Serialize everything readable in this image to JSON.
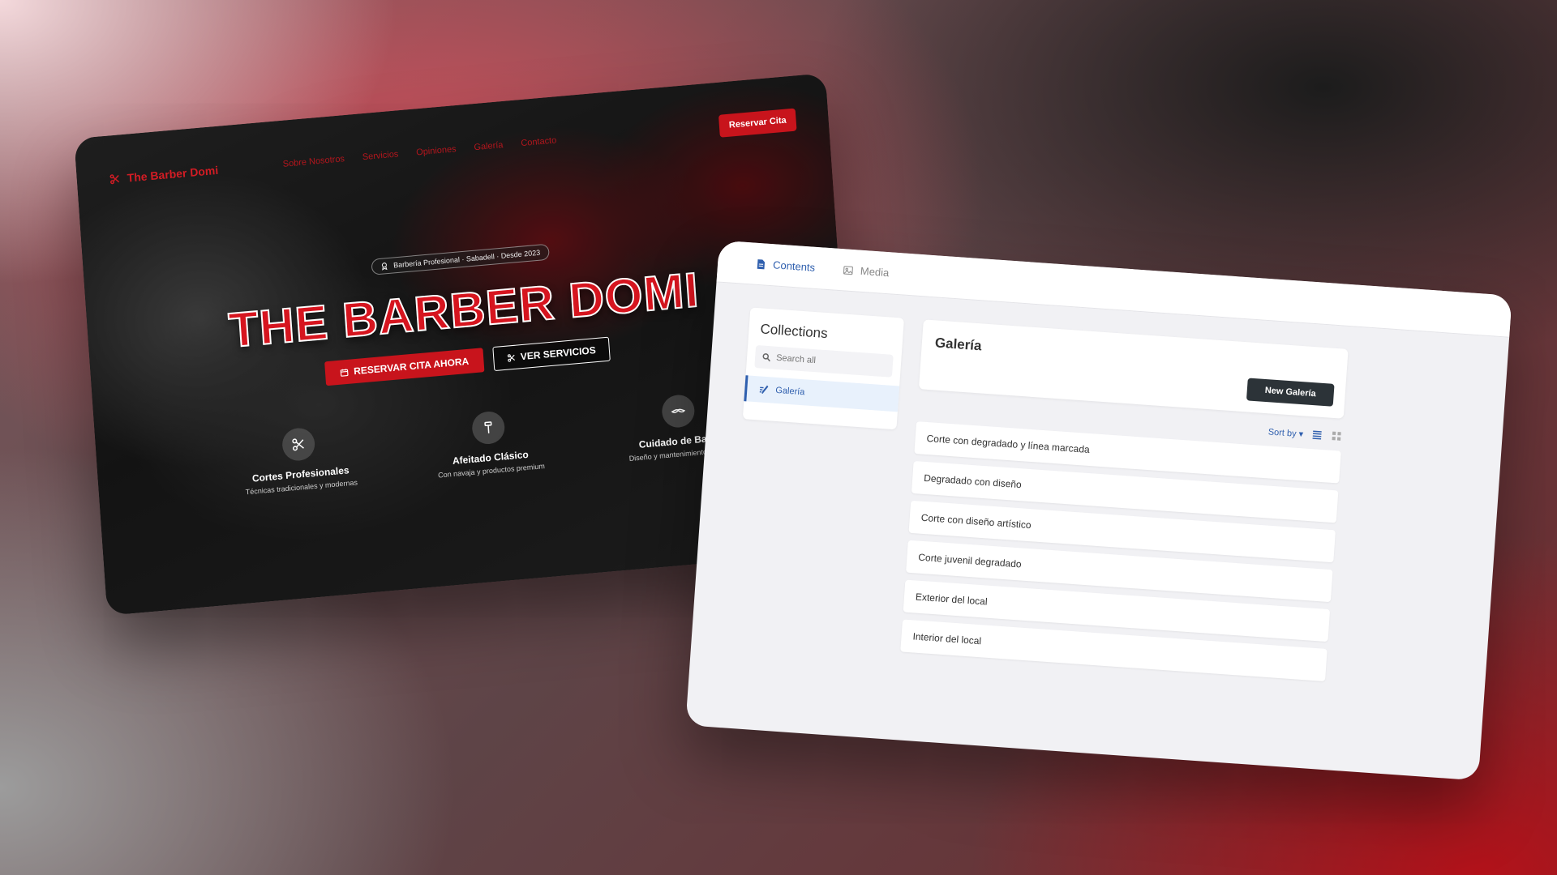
{
  "site": {
    "logo_text": "The Barber Domi",
    "nav_links": [
      "Sobre Nosotros",
      "Servicios",
      "Opiniones",
      "Galería",
      "Contacto"
    ],
    "nav_cta": "Reservar Cita",
    "badge": "Barbería Profesional · Sabadell · Desde 2023",
    "title": "THE BARBER DOMI",
    "cta_primary": "RESERVAR CITA AHORA",
    "cta_secondary": "VER SERVICIOS",
    "features": [
      {
        "icon": "scissors-icon",
        "title": "Cortes Profesionales",
        "subtitle": "Técnicas tradicionales y modernas"
      },
      {
        "icon": "razor-icon",
        "title": "Afeitado Clásico",
        "subtitle": "Con navaja y productos premium"
      },
      {
        "icon": "mustache-icon",
        "title": "Cuidado de Barba",
        "subtitle": "Diseño y mantenimiento experto"
      }
    ],
    "colors": {
      "brand_red": "#c8141c"
    }
  },
  "cms": {
    "tabs": [
      {
        "label": "Contents",
        "icon": "document-icon",
        "active": true
      },
      {
        "label": "Media",
        "icon": "image-icon",
        "active": false
      }
    ],
    "sidebar": {
      "title": "Collections",
      "search_placeholder": "Search all",
      "items": [
        {
          "label": "Galería",
          "icon": "edit-icon",
          "active": true
        }
      ]
    },
    "main": {
      "title": "Galería",
      "new_button": "New Galería",
      "sort_label": "Sort by ▾",
      "entries": [
        "Corte con degradado y línea marcada",
        "Degradado con diseño",
        "Corte con diseño artístico",
        "Corte juvenil degradado",
        "Exterior del local",
        "Interior del local"
      ]
    },
    "colors": {
      "accent": "#2f5fae",
      "dark_button": "#2c3338"
    }
  }
}
